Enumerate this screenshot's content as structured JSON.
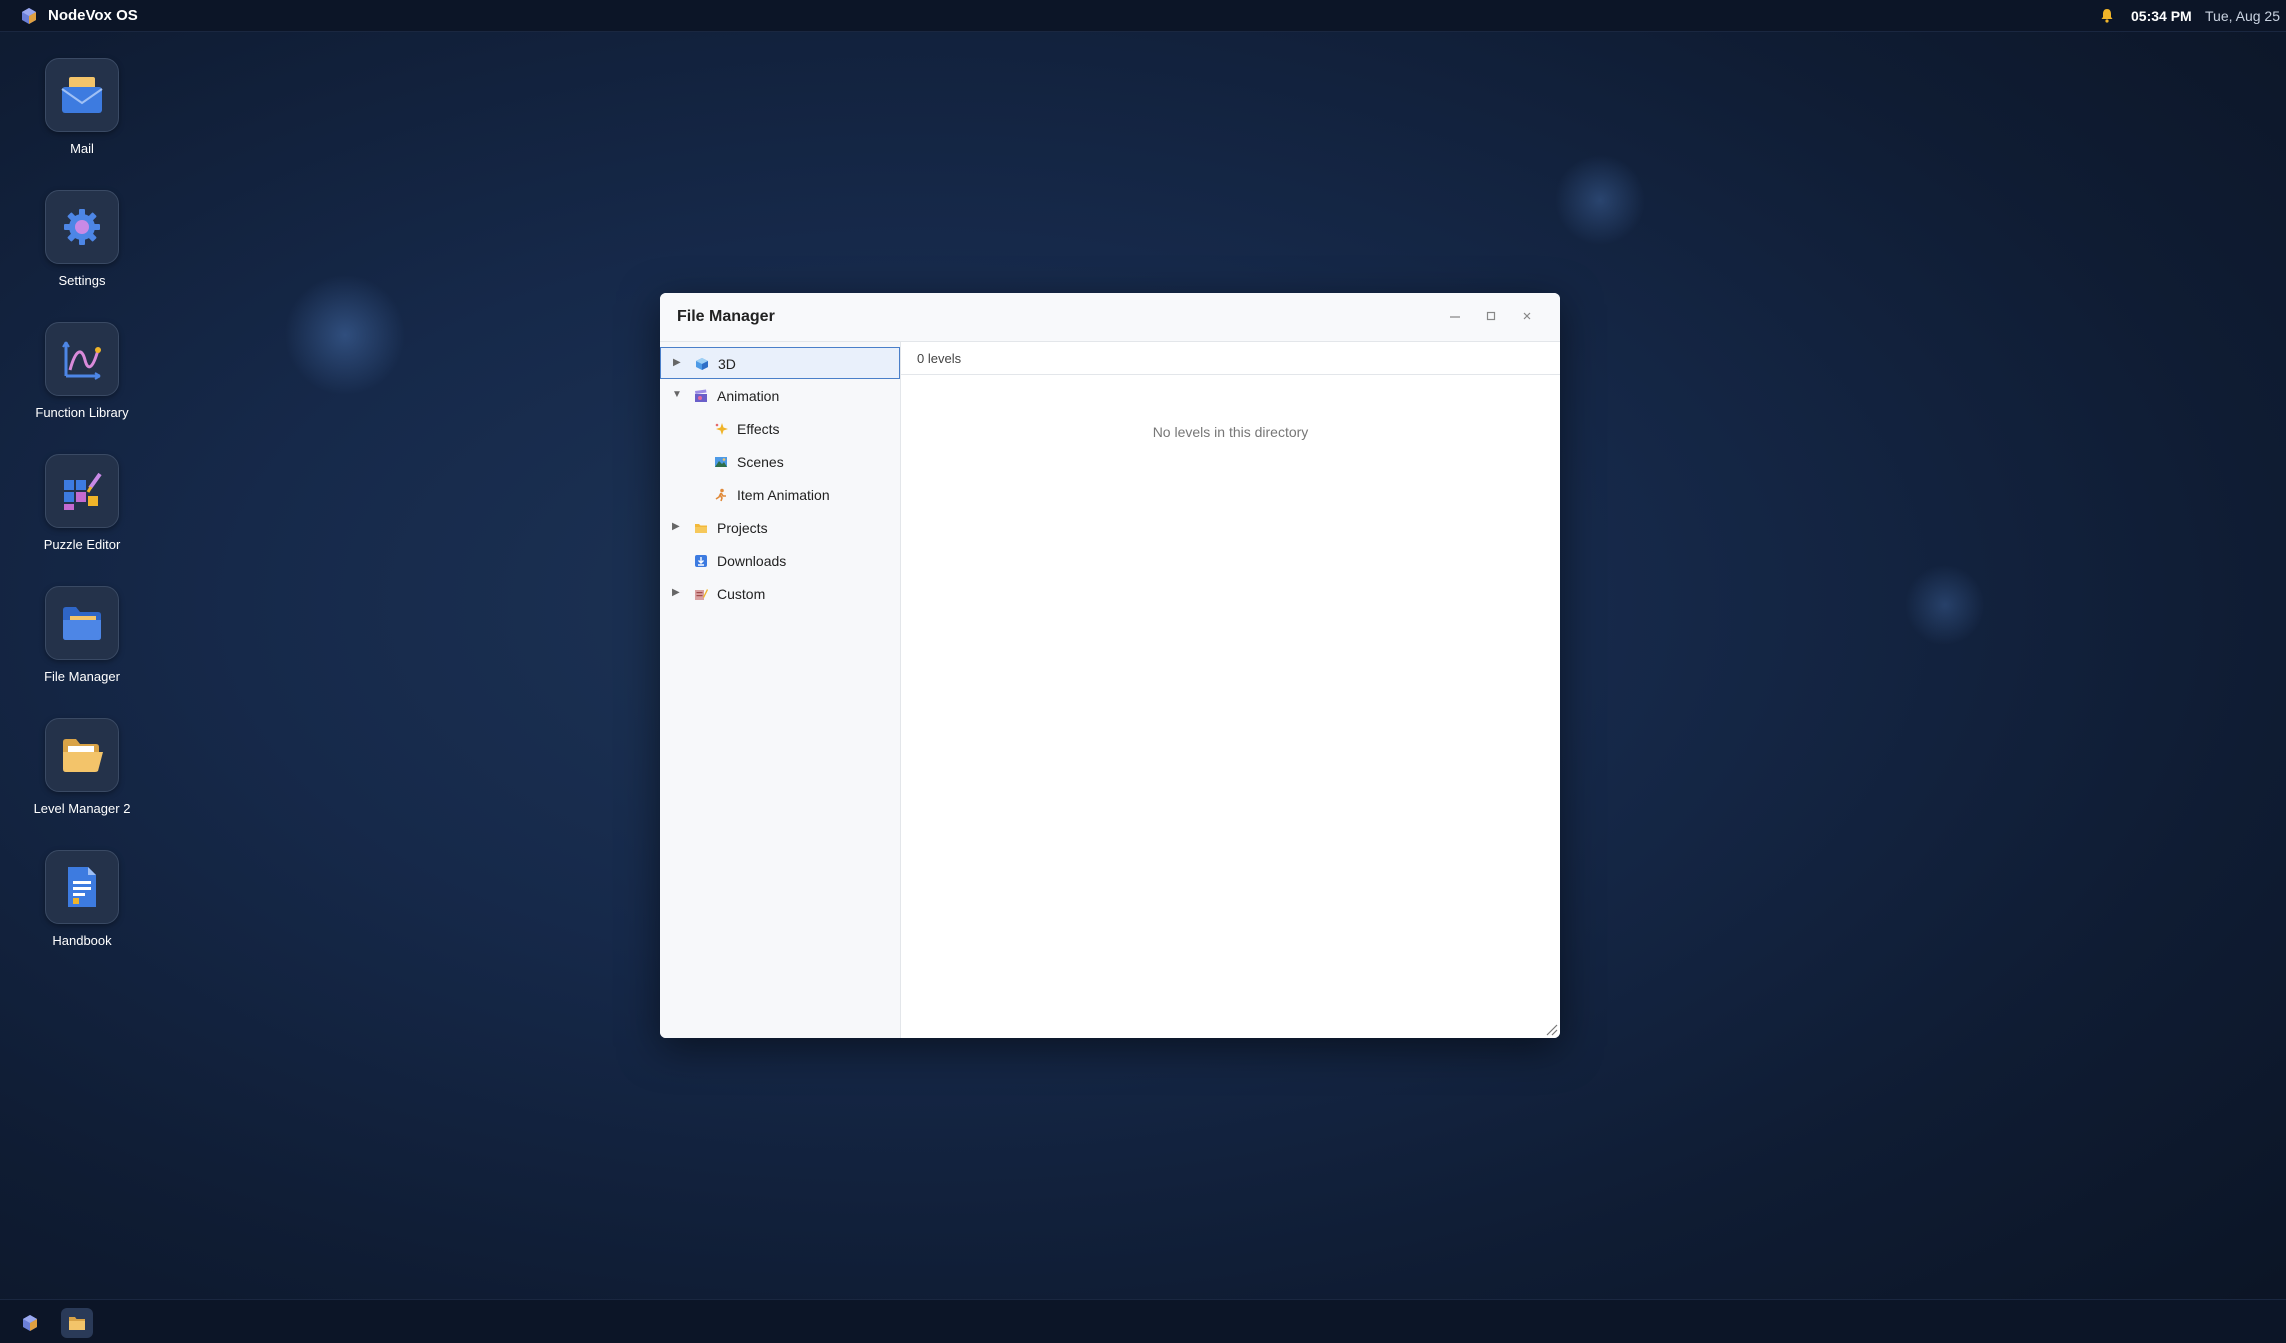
{
  "topbar": {
    "os_name": "NodeVox OS",
    "time": "05:34 PM",
    "date": "Tue, Aug 25",
    "icons": [
      "nodevox-logo-icon",
      "bell-icon"
    ]
  },
  "desktop": {
    "icons": [
      {
        "label": "Mail",
        "icon": "mail-icon"
      },
      {
        "label": "Settings",
        "icon": "gear-icon"
      },
      {
        "label": "Function Library",
        "icon": "function-graph-icon"
      },
      {
        "label": "Puzzle Editor",
        "icon": "puzzle-editor-icon"
      },
      {
        "label": "File Manager",
        "icon": "folder-blue-icon"
      },
      {
        "label": "Level Manager 2",
        "icon": "folder-open-icon"
      },
      {
        "label": "Handbook",
        "icon": "document-icon"
      }
    ]
  },
  "window": {
    "title": "File Manager",
    "controls": [
      "minimize-icon",
      "maximize-icon",
      "close-icon"
    ],
    "tree": [
      {
        "label": "3D",
        "icon": "cube-icon",
        "expander": "collapsed",
        "selected": true
      },
      {
        "label": "Animation",
        "icon": "clapperboard-icon",
        "expander": "expanded"
      },
      {
        "label": "Effects",
        "icon": "sparkle-icon",
        "child": true
      },
      {
        "label": "Scenes",
        "icon": "landscape-icon",
        "child": true
      },
      {
        "label": "Item Animation",
        "icon": "running-figure-icon",
        "child": true
      },
      {
        "label": "Projects",
        "icon": "folder-icon",
        "expander": "collapsed"
      },
      {
        "label": "Downloads",
        "icon": "download-icon"
      },
      {
        "label": "Custom",
        "icon": "custom-icon",
        "expander": "collapsed"
      }
    ],
    "levels_count": "0 levels",
    "empty_message": "No levels in this directory"
  },
  "taskbar": {
    "items": [
      {
        "icon": "nodevox-logo-icon",
        "active": false
      },
      {
        "icon": "file-manager-icon",
        "active": true
      }
    ]
  },
  "colors": {
    "accent": "#4a7fc9",
    "selection_bg": "#e9f0fb",
    "topbar_bg": "#0c1527"
  }
}
